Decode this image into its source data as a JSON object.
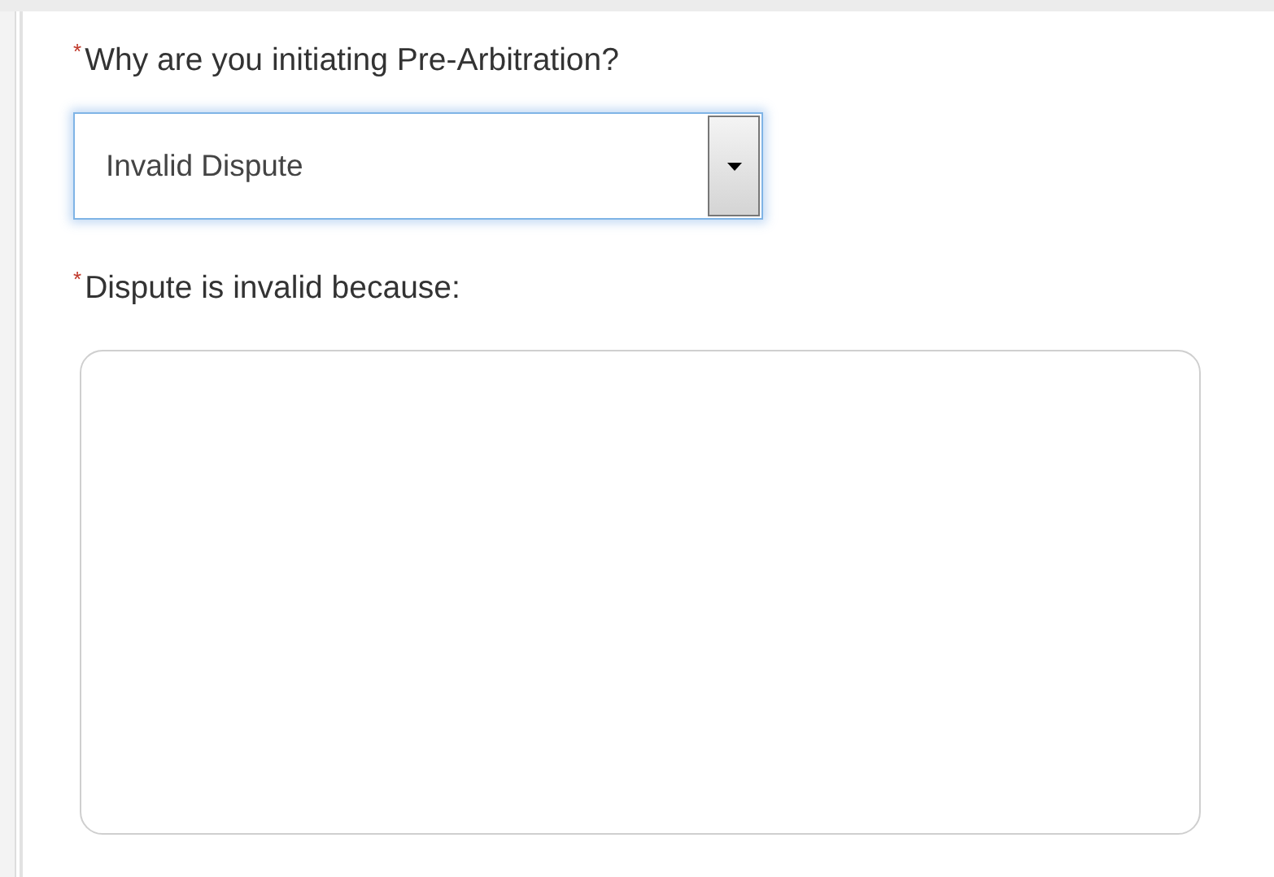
{
  "fields": [
    {
      "kind": "select",
      "required_mark": "*",
      "label": "Why are you initiating Pre-Arbitration?",
      "value": "Invalid Dispute",
      "focused": true
    },
    {
      "kind": "textarea",
      "required_mark": "*",
      "label": "Dispute is invalid because:",
      "focused": false
    }
  ]
}
